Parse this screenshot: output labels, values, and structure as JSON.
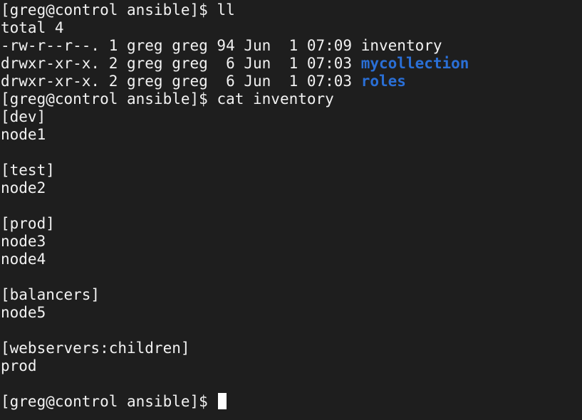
{
  "terminal": {
    "prompt": "[greg@control ansible]$ ",
    "commands": {
      "ll": "ll",
      "cat": "cat inventory"
    },
    "ll_output": {
      "total": "total 4",
      "rows": [
        {
          "prefix": "-rw-r--r--. 1 greg greg 94 Jun  1 07:09 ",
          "name": "inventory"
        },
        {
          "prefix": "drwxr-xr-x. 2 greg greg  6 Jun  1 07:03 ",
          "name": "mycollection"
        },
        {
          "prefix": "drwxr-xr-x. 2 greg greg  6 Jun  1 07:03 ",
          "name": "roles"
        }
      ]
    },
    "inventory_lines": [
      "[dev]",
      "node1",
      "",
      "[test]",
      "node2",
      "",
      "[prod]",
      "node3",
      "node4",
      "",
      "[balancers]",
      "node5",
      "",
      "[webservers:children]",
      "prod",
      ""
    ],
    "colors": {
      "background": "#1e1e1e",
      "foreground": "#f2f2f2",
      "directory": "#2a6fd6"
    }
  }
}
